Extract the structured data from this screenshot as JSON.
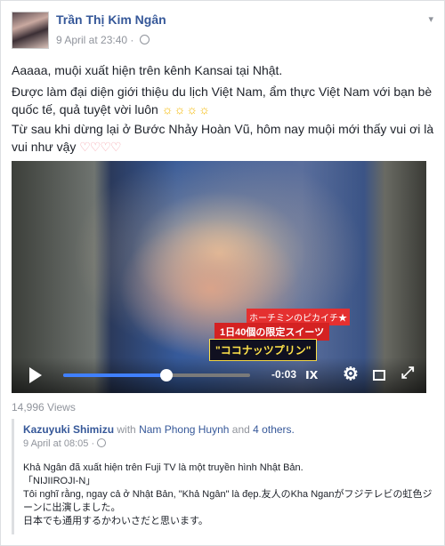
{
  "post": {
    "author": "Trần Thị Kim Ngân",
    "time": "9 April at 23:40",
    "dot": "·",
    "lines": [
      "Aaaaa, muội xuất hiện trên kênh Kansai tại Nhật.",
      "Được làm đại diện giới thiệu du lịch Việt Nam, ẩm thực Việt Nam với bạn bè quốc tế, quả tuyệt vời luôn",
      "Từ sau khi dừng lại ở Bước Nhảy Hoàn Vũ, hôm nay muội mới thấy vui ơi là vui như vậy"
    ],
    "emoji_suns": "☼☼☼☼",
    "emoji_hearts": "♡♡♡♡"
  },
  "video": {
    "tv_tag": "ホーチミンのピカイチ★",
    "tv_top": "1日40個の限定スイーツ",
    "tv_bottom": "\"ココナッツプリン\"",
    "time_left": "-0:03",
    "progress": 0.55,
    "icons": [
      "play-icon",
      "mute-icon",
      "gear-icon",
      "theater-icon",
      "fullscreen-icon"
    ]
  },
  "views": "14,996 Views",
  "shared": {
    "author": "Kazuyuki Shimizu",
    "with_word": "with",
    "tagged": "Nam Phong Huynh",
    "and_word": "and",
    "others": "4 others.",
    "time": "9 April at 08:05",
    "dot": "·",
    "lines": [
      "Khả Ngân đã xuất hiện trên Fuji TV là một truyền hình Nhật Bản.",
      "「NIJIIROJI-N」",
      "Tôi nghĩ rằng, ngay cả ở Nhật Bản, \"Khả Ngân\" là đẹp.友人のKha Nganがフジテレビの虹色ジーンに出演しました。",
      "日本でも通用するかわいさだと思います。"
    ]
  },
  "colors": {
    "link": "#365899",
    "meta": "#90949c",
    "progress": "#4080ff"
  }
}
